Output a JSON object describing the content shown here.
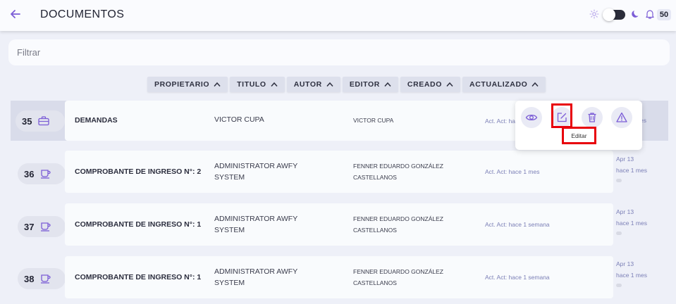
{
  "header": {
    "title": "DOCUMENTOS",
    "notifications_count": "50",
    "icons": [
      "back-arrow-icon",
      "sun-icon",
      "moon-icon",
      "bell-icon"
    ],
    "accent_color": "#7b5cd6"
  },
  "filter": {
    "placeholder": "Filtrar",
    "value": ""
  },
  "sort_columns": [
    {
      "label": "PROPIETARIO"
    },
    {
      "label": "TITULO"
    },
    {
      "label": "AUTOR"
    },
    {
      "label": "EDITOR"
    },
    {
      "label": "CREADO"
    },
    {
      "label": "ACTUALIZADO"
    }
  ],
  "rows": [
    {
      "num": "35",
      "icon": "briefcase-icon",
      "name": "DEMANDAS",
      "owner": "VICTOR CUPA",
      "author": "VICTOR CUPA",
      "updated": "Act. Act: ha",
      "side_tail": "es",
      "selected": true
    },
    {
      "num": "36",
      "icon": "cup-icon",
      "name": "COMPROBANTE DE INGRESO N°: 2",
      "owner": "ADMINISTRATOR AWFY SYSTEM",
      "author": "FENNER EDUARDO GONZÁLEZ CASTELLANOS",
      "updated": "Act. Act: hace 1 mes",
      "created_date": "Apr 13",
      "created_ago": "hace 1 mes"
    },
    {
      "num": "37",
      "icon": "cup-icon",
      "name": "COMPROBANTE DE INGRESO N°: 1",
      "owner": "ADMINISTRATOR AWFY SYSTEM",
      "author": "FENNER EDUARDO GONZÁLEZ CASTELLANOS",
      "updated": "Act. Act: hace 1 semana",
      "created_date": "Apr 13",
      "created_ago": "hace 1 mes"
    },
    {
      "num": "38",
      "icon": "cup-icon",
      "name": "COMPROBANTE DE INGRESO N°: 1",
      "owner": "ADMINISTRATOR AWFY SYSTEM",
      "author": "FENNER EDUARDO GONZÁLEZ CASTELLANOS",
      "updated": "Act. Act: hace 1 semana",
      "created_date": "Apr 13",
      "created_ago": "hace 1 mes"
    }
  ],
  "actions_popup": {
    "actions": [
      "eye-icon",
      "edit-icon",
      "trash-icon",
      "warning-icon"
    ],
    "tooltip": "Editar",
    "highlight_color": "#e8000b"
  }
}
